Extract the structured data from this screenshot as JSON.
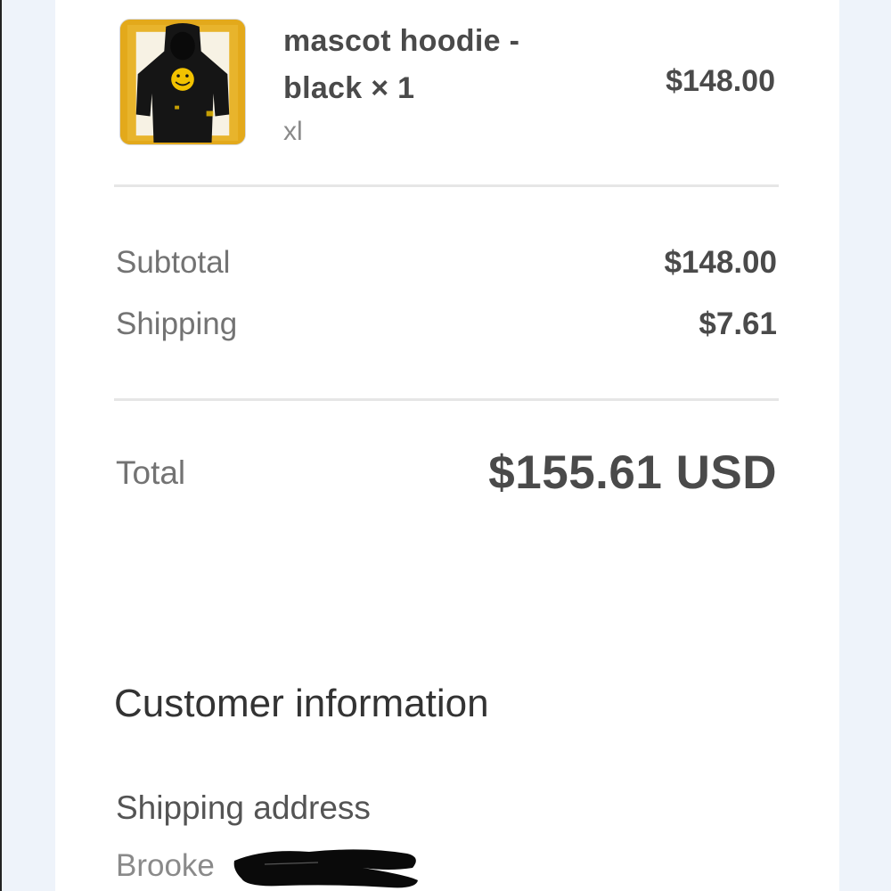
{
  "order_summary": {
    "item": {
      "name": "mascot hoodie - black × 1",
      "variant": "xl",
      "price": "$148.00",
      "thumbnail_icon": "hoodie-thumbnail"
    },
    "subtotal": {
      "label": "Subtotal",
      "value": "$148.00"
    },
    "shipping": {
      "label": "Shipping",
      "value": "$7.61"
    },
    "total": {
      "label": "Total",
      "value": "$155.61 USD"
    }
  },
  "customer_information": {
    "title": "Customer information",
    "shipping_address": {
      "label": "Shipping address",
      "name": "Brooke"
    }
  },
  "colors": {
    "background": "#eef3fa",
    "card": "#ffffff",
    "text_dark": "#4a4a4a",
    "text_muted": "#737373",
    "thumbnail_accent": "#e3a91b"
  }
}
